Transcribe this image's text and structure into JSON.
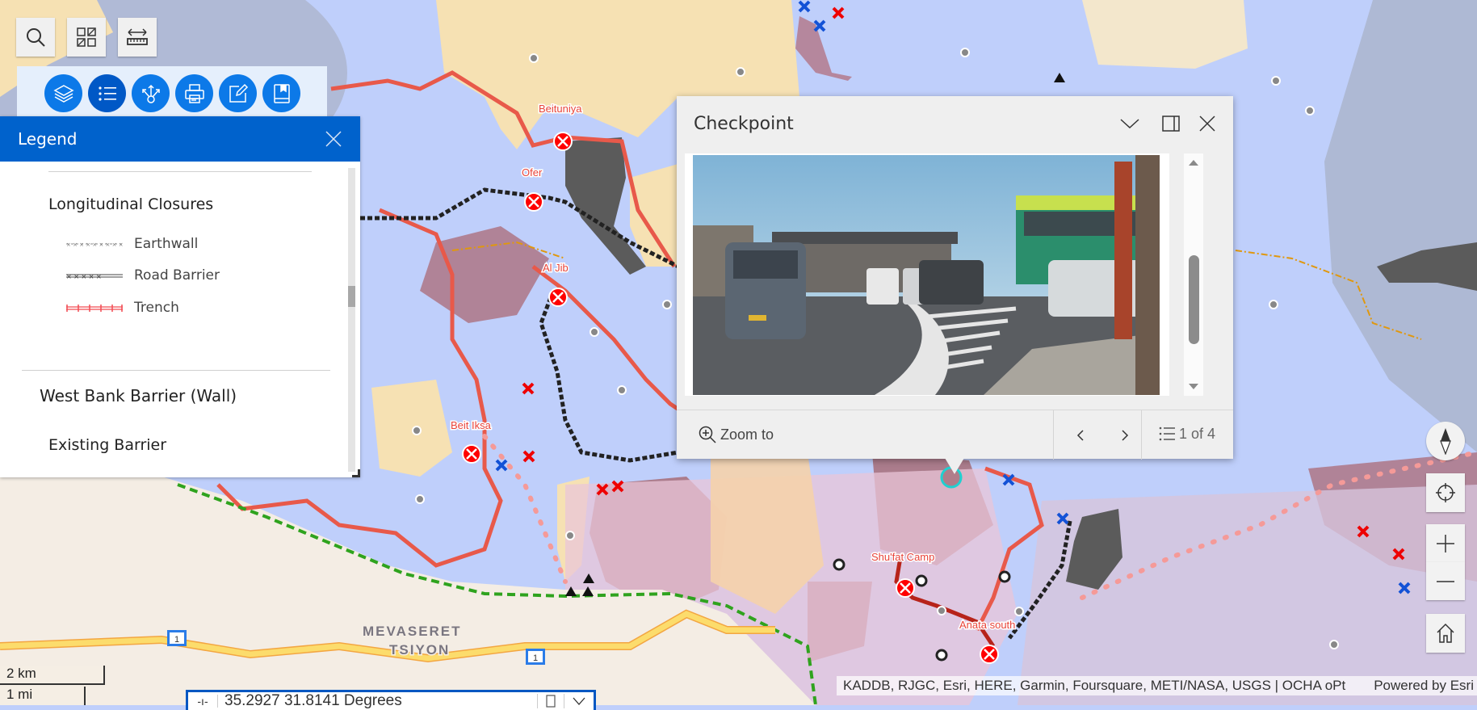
{
  "toolbar": {
    "top_tools": [
      {
        "name": "search-button",
        "icon": "search-icon"
      },
      {
        "name": "select-button",
        "icon": "select-grid-icon"
      },
      {
        "name": "measure-button",
        "icon": "ruler-measure-icon"
      }
    ],
    "widgets": [
      {
        "name": "layers-button",
        "icon": "layers-icon",
        "active": false
      },
      {
        "name": "legend-button",
        "icon": "list-icon",
        "active": true
      },
      {
        "name": "share-button",
        "icon": "share-icon",
        "active": false
      },
      {
        "name": "print-button",
        "icon": "printer-icon",
        "active": false
      },
      {
        "name": "edit-button",
        "icon": "edit-icon",
        "active": false
      },
      {
        "name": "bookmarks-button",
        "icon": "bookmark-icon",
        "active": false
      }
    ]
  },
  "legend": {
    "title": "Legend",
    "section_title": "Longitudinal Closures",
    "items": [
      {
        "label": "Earthwall",
        "symbol": "earthwall-line"
      },
      {
        "label": "Road Barrier",
        "symbol": "road-barrier-line"
      },
      {
        "label": "Trench",
        "symbol": "trench-line"
      }
    ],
    "layer_title": "West Bank Barrier (Wall)",
    "sublayer_title": "Existing Barrier"
  },
  "popup": {
    "title": "Checkpoint",
    "image_alt": "Photo of checkpoint with cars queued at the crossing",
    "zoom_to_label": "Zoom to",
    "feature_index": 1,
    "feature_total": 4,
    "feature_count_label": "1 of 4"
  },
  "map_labels": {
    "places": [
      "Beituniya",
      "Ofer",
      "Al Jib",
      "Beit Iksa",
      "Shu'fat Camp",
      "Anata south"
    ],
    "town_line1": "MEVASERET",
    "town_line2": "TSIYON",
    "road_shield": "1"
  },
  "scalebar": {
    "metric": "2 km",
    "imperial": "1 mi"
  },
  "coordinates": {
    "value": "35.2927 31.8141 Degrees"
  },
  "attribution": {
    "text": "KADDB, RJGC, Esri, HERE, Garmin, Foursquare, METI/NASA, USGS | OCHA oPt",
    "powered_by": "Powered by Esri"
  },
  "colors": {
    "accent": "#0062cc",
    "widget_blue": "#0c79e8",
    "checkpoint_red": "#e8443a",
    "barrier_line": "#e8594a",
    "green_line": "#2fa31e"
  }
}
